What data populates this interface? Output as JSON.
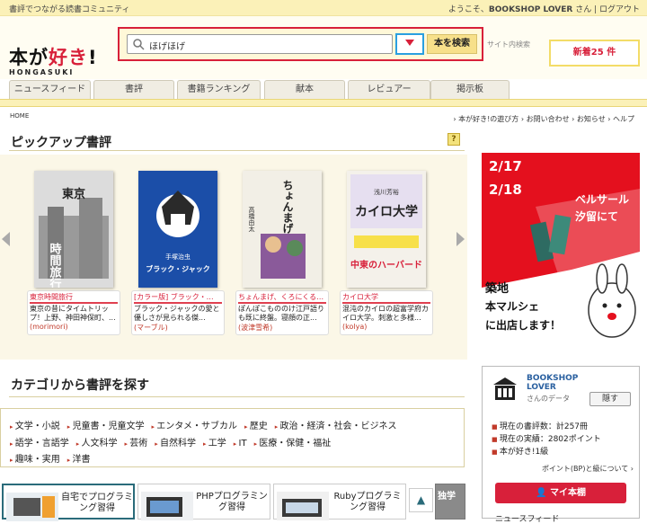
{
  "topbar": {
    "tagline": "書評でつながる読書コミュニティ",
    "welcome": "ようこそ、",
    "username": "BOOKSHOP LOVER",
    "san": "さん",
    "logout": "ログアウト"
  },
  "logo": {
    "main_a": "本が",
    "main_b": "好き",
    "main_c": "!",
    "sub": "HONGASUKI"
  },
  "search": {
    "value": "ほげほげ",
    "button": "本を検索",
    "site_search": "サイト内検索"
  },
  "new_badge": "新着25 件",
  "tabs": [
    "ニュースフィード",
    "書評",
    "書籍ランキング",
    "献本",
    "レビュアー",
    "掲示板"
  ],
  "breadcrumb": "HOME",
  "sublinks": "› 本が好き!の遊び方 › お問い合わせ › お知らせ › ヘルプ",
  "pickup": {
    "title": "ピックアップ書評",
    "books": [
      {
        "title": "東京時間旅行",
        "desc": "東京の昔にタイムトリップ！上野、神田神保町、...",
        "user": "(morimori)",
        "cover_text": "東京時間旅行",
        "cover_color": "#e8e8e8"
      },
      {
        "title": "[カラー版] ブラック・…",
        "desc": "ブラック・ジャックの愛と優しさが見られる傑...",
        "user": "(マーブル)",
        "cover_text": "ブラック・ジャック",
        "cover_color": "#1b4ea8"
      },
      {
        "title": "ちょんまげ、くろにくる…",
        "desc": "ぽんぽこもののけ江戸語りも既に終盤。寝顔の正...",
        "user": "(波津雪希)",
        "cover_text": "ちょんまげ、くろにくる",
        "cover_color": "#f2efe6"
      },
      {
        "title": "カイロ大学",
        "desc": "混沌のカイロの超富学府カイロ大学。刺激と多様...",
        "user": "(kolya)",
        "cover_text": "カイロ大学",
        "cover_color": "#f4f1ea"
      }
    ]
  },
  "promo": {
    "date1": "2/17",
    "date2": "2/18",
    "venue1": "ベルサール",
    "venue2": "汐留にて",
    "line1": "築地",
    "line2": "本マルシェ",
    "line3": "に出店します！"
  },
  "category": {
    "title": "カテゴリから書評を探す",
    "row1": [
      "文学・小説",
      "児童書・児童文学",
      "エンタメ・サブカル",
      "歴史",
      "政治・経済・社会・ビジネス"
    ],
    "row2": [
      "語学・言語学",
      "人文科学",
      "芸術",
      "自然科学",
      "工学",
      "IT",
      "医療・保健・福祉"
    ],
    "row3": [
      "趣味・実用",
      "洋書"
    ]
  },
  "bottom_cards": [
    "自宅でプログラミング習得",
    "PHPプログラミング習得",
    "Rubyプログラミング習得",
    "独学"
  ],
  "sidebar": {
    "name_line1": "BOOKSHOP",
    "name_line2": "LOVER",
    "data_label": "さんのデータ",
    "hide": "隠す",
    "reviews": "現在の書評数：計257冊",
    "points": "現在の実績：2802ポイント",
    "rank": "本が好き!1級",
    "bp_link": "ポイント(BP)と級について ›",
    "mybook": "マイ本棚",
    "feed": "ニュースフィード"
  }
}
